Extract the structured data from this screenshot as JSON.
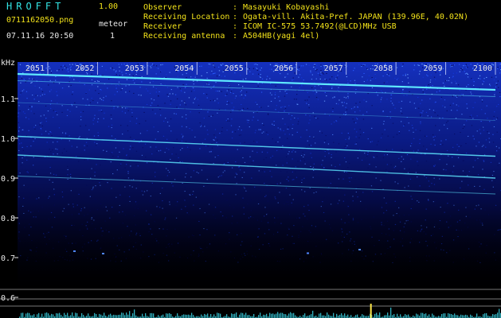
{
  "app": {
    "name": "HROFFT",
    "version": "1.00",
    "file_name": "0711162050.png",
    "datetime": "07.11.16 20:50",
    "meteor_label": "meteor",
    "meteor_count": "1"
  },
  "info": {
    "colon": ":",
    "rows": [
      {
        "label": "Observer",
        "value": "Masayuki Kobayashi"
      },
      {
        "label": "Receiving Location",
        "value": "Ogata-vill. Akita-Pref. JAPAN (139.96E, 40.02N)"
      },
      {
        "label": "Receiver",
        "value": "ICOM IC-575 53.7492(@LCD)MHz USB"
      },
      {
        "label": "Receiving antenna",
        "value": "A504HB(yagi 4el)"
      }
    ]
  },
  "spectrogram": {
    "freq_unit": "kHz",
    "freq_ticks": [
      {
        "value": 1.1,
        "label": "1.1"
      },
      {
        "value": 1.0,
        "label": "1.0"
      },
      {
        "value": 0.9,
        "label": "0.9"
      },
      {
        "value": 0.8,
        "label": "0.8"
      },
      {
        "value": 0.7,
        "label": "0.7"
      },
      {
        "value": 0.6,
        "label": "0.6"
      }
    ],
    "time_labels": [
      "2051",
      "2052",
      "2053",
      "2054",
      "2055",
      "2056",
      "2057",
      "2058",
      "2059",
      "2100"
    ],
    "meteor_echo": {
      "time": "2057",
      "strength": "high"
    },
    "colors": {
      "background": "#000000",
      "noise_dark": "#05085a",
      "noise_mid": "#1436d8",
      "noise_bright": "#4f86ff",
      "carrier": "#5fe8ff",
      "signal_bars": "#3ad0e0",
      "meteor": "#ffe84a",
      "level_lines": "#c8c8c8"
    }
  }
}
